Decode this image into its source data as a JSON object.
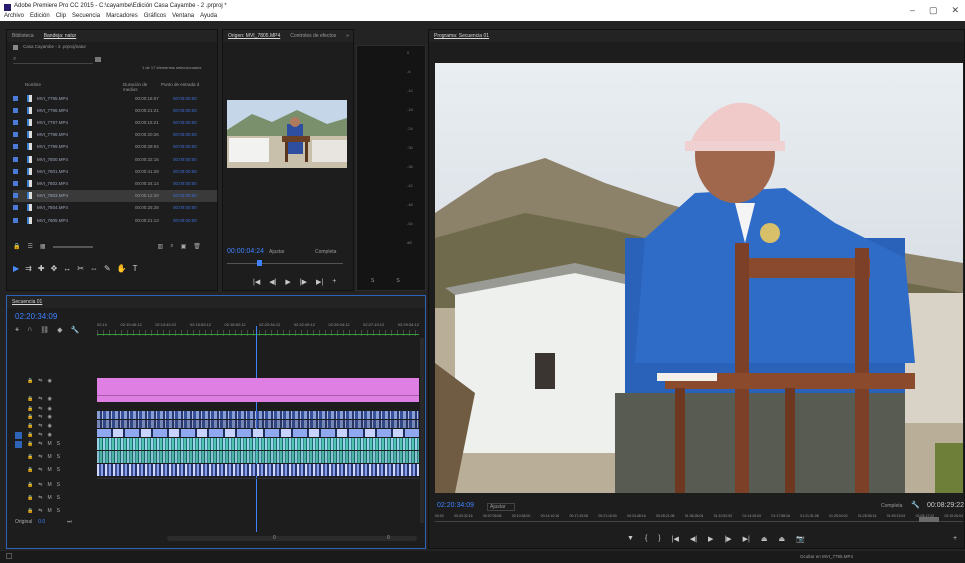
{
  "window": {
    "title": "Adobe Premiere Pro CC 2015 - C:\\cayambe\\Edición Casa Cayambe - 2 .prproj *",
    "menu": [
      "Archivo",
      "Edición",
      "Clip",
      "Secuencia",
      "Marcadores",
      "Gráficos",
      "Ventana",
      "Ayuda"
    ],
    "controls": [
      "–",
      "▢",
      "✕"
    ]
  },
  "project_panel": {
    "tabs": [
      "Biblioteca",
      "Bandeja: natur"
    ],
    "bin_path": "Casa Cayambe - 2 .prproj/natur",
    "search_placeholder": "",
    "count_text": "1 de 17 elementos seleccionados",
    "columns": {
      "name": "Nombre",
      "duration": "Duración de medios",
      "in_point": "Punto de entrada d"
    },
    "rows": [
      {
        "name": "MVI_7795.MP4",
        "duration": "00:00:16:07",
        "in_point": "00:00:00:00"
      },
      {
        "name": "MVI_7796.MP4",
        "duration": "00:00:21:21",
        "in_point": "00:00:00:00"
      },
      {
        "name": "MVI_7797.MP4",
        "duration": "00:00:15:21",
        "in_point": "00:00:00:00"
      },
      {
        "name": "MVI_7798.MP4",
        "duration": "00:00:20:26",
        "in_point": "00:00:00:00"
      },
      {
        "name": "MVI_7799.MP4",
        "duration": "00:00:29:04",
        "in_point": "00:00:00:00"
      },
      {
        "name": "MVI_7800.MP4",
        "duration": "00:00:32:16",
        "in_point": "00:00:00:00"
      },
      {
        "name": "MVI_7801.MP4",
        "duration": "00:00:41:29",
        "in_point": "00:00:00:00"
      },
      {
        "name": "MVI_7802.MP4",
        "duration": "00:00:34:14",
        "in_point": "00:00:00:00"
      },
      {
        "name": "MVI_7803.MP4",
        "duration": "00:00:12:20",
        "in_point": "00:00:00:00"
      },
      {
        "name": "MVI_7804.MP4",
        "duration": "00:00:25:28",
        "in_point": "00:00:00:00"
      },
      {
        "name": "MVI_7805.MP4",
        "duration": "00:00:21:13",
        "in_point": "00:00:00:00"
      }
    ],
    "selected_row": 8
  },
  "source_panel": {
    "tabs": [
      "Origen: MVI_7805.MP4",
      "Controles de efectos"
    ],
    "timecode": "00:00:04:24",
    "fit": "Ajustar",
    "quality": "Completa",
    "scope_scale": [
      "0",
      "-6",
      "-12",
      "-18",
      "-24",
      "-30",
      "-36",
      "-42",
      "-48",
      "-54",
      "dB"
    ],
    "scope_labels": [
      "S",
      "S"
    ]
  },
  "program_panel": {
    "tab": "Programa: Secuencia 01",
    "timecode": "02:20:34:09",
    "fit": "Ajustar",
    "quality": "Completa",
    "duration": "00:08:29:22",
    "ruler": [
      "00:00",
      "00:03:32:16",
      "00:07:05:08",
      "00:10:38:00",
      "00:14:10:16",
      "00:17:43:08",
      "00:21:16:00",
      "00:24:48:16",
      "00:28:21:08",
      "01:06:28:04",
      "01:10:52:00",
      "01:14:26:00",
      "01:17:58:16",
      "01:21:31:08",
      "01:25:04:00",
      "01:28:36:16",
      "01:59:13:04",
      "02:03:17:22",
      "02:10:26:04"
    ],
    "status": "Ocultar en MVI_7795.MP4"
  },
  "timeline_panel": {
    "tab": "Secuencia 01",
    "timecode": "02:20:34:09",
    "ruler": [
      "02:10",
      "02:10:45:12",
      "02:13:40:12",
      "02:15:53:12",
      "02:18:52:12",
      "02:20:34:12",
      "02:22:49:12",
      "02:25:04:12",
      "02:27:19:12",
      "02:29:34:12"
    ],
    "tracks": [
      {
        "id": "V6",
        "kind": "video"
      },
      {
        "id": "V5",
        "kind": "video"
      },
      {
        "id": "V4",
        "kind": "video"
      },
      {
        "id": "V3",
        "kind": "video"
      },
      {
        "id": "V2",
        "kind": "video"
      },
      {
        "id": "V1",
        "kind": "video"
      },
      {
        "id": "A1",
        "kind": "audio"
      },
      {
        "id": "A2",
        "kind": "audio"
      },
      {
        "id": "A3",
        "kind": "audio"
      },
      {
        "id": "A4",
        "kind": "audio"
      },
      {
        "id": "A5",
        "kind": "audio"
      },
      {
        "id": "A6",
        "kind": "audio"
      }
    ],
    "master_label": "Original",
    "master_value": "0.0",
    "scroll_values": [
      "0",
      "0"
    ],
    "colors": {
      "pink_clip": "#df7ee3",
      "video_clip": "#8fa8f0",
      "audio_clip": "#55c3b0",
      "selection_blue": "#2e64b8"
    }
  },
  "tools": [
    "selection",
    "track-select",
    "ripple",
    "rolling",
    "rate-stretch",
    "razor",
    "slip",
    "pen",
    "hand",
    "type"
  ]
}
